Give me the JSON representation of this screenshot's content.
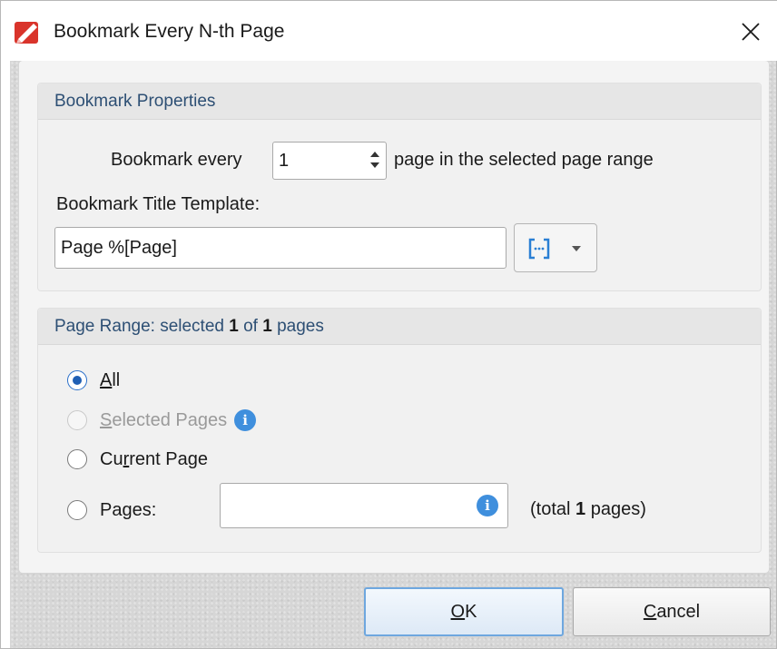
{
  "window": {
    "title": "Bookmark Every N-th Page",
    "app_icon": "pdf-editor-icon",
    "close_icon": "close-icon"
  },
  "bookmark_properties": {
    "header": "Bookmark Properties",
    "every_label": "Bookmark every",
    "every_value": "1",
    "every_suffix": "page in the selected page range",
    "title_template_label": "Bookmark Title Template:",
    "title_template_value": "Page %[Page]",
    "macro_button_icon": "macro-insert-icon",
    "macro_dropdown_icon": "chevron-down-icon"
  },
  "page_range": {
    "header_prefix": "Page Range: selected ",
    "selected_count": "1",
    "header_mid": " of ",
    "total_count": "1",
    "header_suffix": " pages",
    "options": {
      "all": {
        "accel": "A",
        "rest": "ll",
        "checked": true,
        "enabled": true
      },
      "selected_pages": {
        "accel": "S",
        "rest": "elected Pages",
        "checked": false,
        "enabled": false
      },
      "current_page": {
        "pre": "Cu",
        "accel": "r",
        "rest": "rent Page",
        "checked": false,
        "enabled": true
      },
      "pages": {
        "pre": "Pa",
        "accel": "g",
        "rest": "es:",
        "checked": false,
        "enabled": true
      }
    },
    "pages_input_value": "",
    "total_prefix": "(total ",
    "total_value": "1",
    "total_suffix": " pages)"
  },
  "buttons": {
    "ok": {
      "accel": "O",
      "rest": "K"
    },
    "cancel": {
      "accel": "C",
      "rest": "ancel"
    }
  },
  "colors": {
    "accent": "#1f5fb4",
    "info": "#3f8fdd",
    "header_text": "#2d4f74",
    "app_icon_red": "#d9342b"
  }
}
